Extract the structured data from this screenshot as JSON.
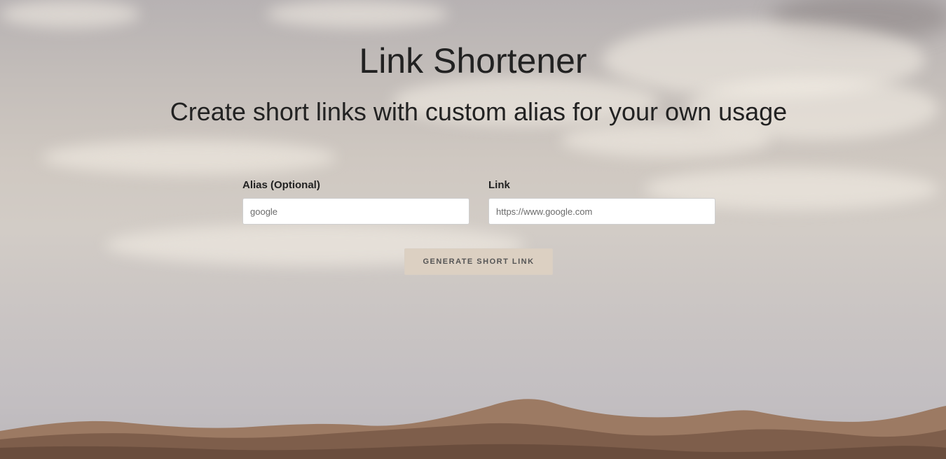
{
  "header": {
    "title": "Link Shortener",
    "subtitle": "Create short links with custom alias for your own usage"
  },
  "form": {
    "alias": {
      "label": "Alias (Optional)",
      "placeholder": "google",
      "value": ""
    },
    "link": {
      "label": "Link",
      "placeholder": "https://www.google.com",
      "value": ""
    },
    "submit_label": "GENERATE SHORT LINK"
  },
  "colors": {
    "button_bg": "#dcd0c2",
    "text": "#222222",
    "dune": "#8a6a55"
  }
}
